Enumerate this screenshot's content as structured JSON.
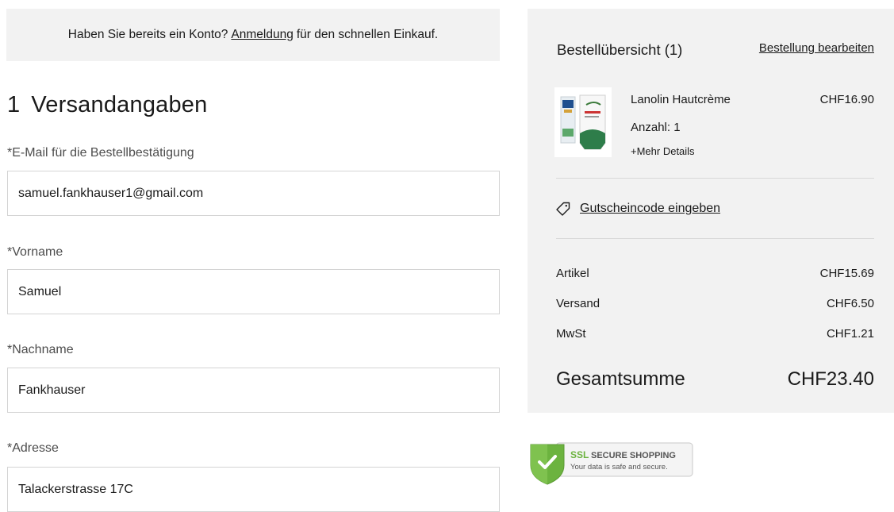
{
  "login_banner": {
    "prefix": "Haben Sie bereits ein Konto?",
    "link": "Anmeldung",
    "suffix": "für den schnellen Einkauf."
  },
  "section": {
    "number": "1",
    "title": "Versandangaben"
  },
  "fields": {
    "email": {
      "label": "*E-Mail für die Bestellbestätigung",
      "value": "samuel.fankhauser1@gmail.com"
    },
    "firstname": {
      "label": "*Vorname",
      "value": "Samuel"
    },
    "lastname": {
      "label": "*Nachname",
      "value": "Fankhauser"
    },
    "address": {
      "label": "*Adresse",
      "value": "Talackerstrasse 17C"
    }
  },
  "summary": {
    "title": "Bestellübersicht (1)",
    "edit_link": "Bestellung bearbeiten",
    "product": {
      "name": "Lanolin Hautcrème",
      "price": "CHF16.90",
      "quantity": "Anzahl: 1",
      "more": "+Mehr Details"
    },
    "coupon": "Gutscheincode eingeben",
    "rows": {
      "items": {
        "label": "Artikel",
        "value": "CHF15.69"
      },
      "shipping": {
        "label": "Versand",
        "value": "CHF6.50"
      },
      "vat": {
        "label": "MwSt",
        "value": "CHF1.21"
      }
    },
    "total": {
      "label": "Gesamtsumme",
      "value": "CHF23.40"
    }
  },
  "ssl": {
    "ssl": "SSL",
    "secure": "SECURE SHOPPING",
    "tagline": "Your data is safe and secure."
  },
  "colors": {
    "panel_bg": "#f2f2f2",
    "badge_green": "#6cb33f"
  }
}
